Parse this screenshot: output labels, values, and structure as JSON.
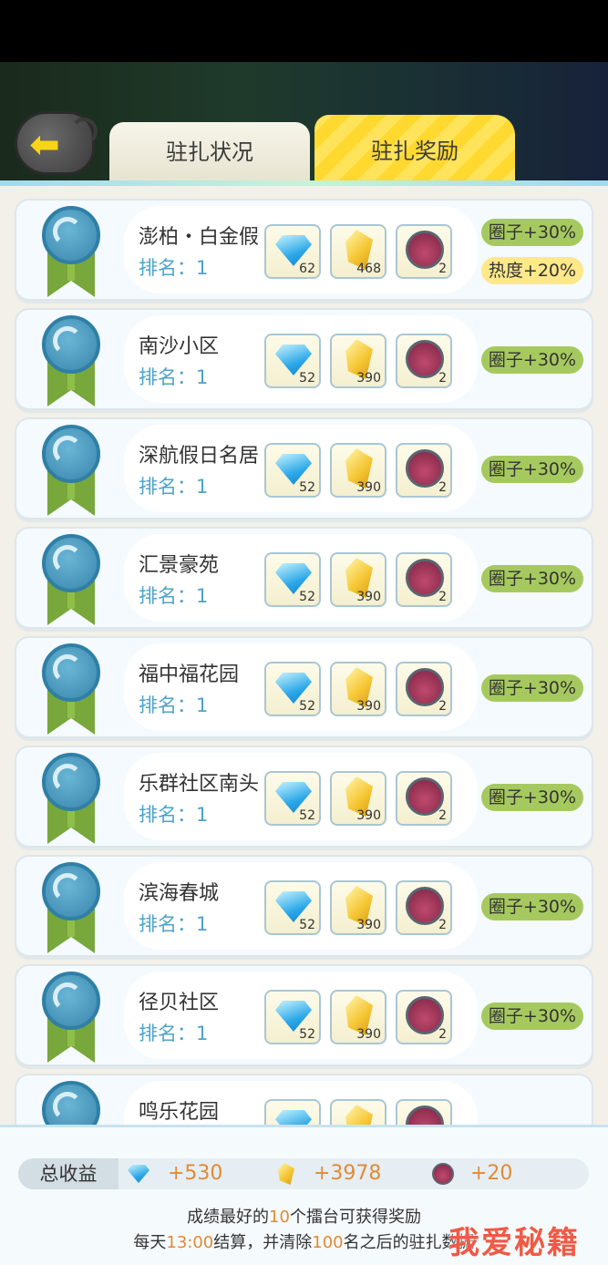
{
  "tabs": [
    {
      "label": "驻扎状况",
      "active": false
    },
    {
      "label": "驻扎奖励",
      "active": true
    }
  ],
  "rank_prefix": "排名：",
  "rows": [
    {
      "name": "澎柏・白金假",
      "rank": "1",
      "gem": "62",
      "gold": "468",
      "pet": "2",
      "badges": [
        "圈子+30%",
        "热度+20%"
      ]
    },
    {
      "name": "南沙小区",
      "rank": "1",
      "gem": "52",
      "gold": "390",
      "pet": "2",
      "badges": [
        "圈子+30%"
      ]
    },
    {
      "name": "深航假日名居",
      "rank": "1",
      "gem": "52",
      "gold": "390",
      "pet": "2",
      "badges": [
        "圈子+30%"
      ]
    },
    {
      "name": "汇景豪苑",
      "rank": "1",
      "gem": "52",
      "gold": "390",
      "pet": "2",
      "badges": [
        "圈子+30%"
      ]
    },
    {
      "name": "福中福花园",
      "rank": "1",
      "gem": "52",
      "gold": "390",
      "pet": "2",
      "badges": [
        "圈子+30%"
      ]
    },
    {
      "name": "乐群社区南头",
      "rank": "1",
      "gem": "52",
      "gold": "390",
      "pet": "2",
      "badges": [
        "圈子+30%"
      ]
    },
    {
      "name": "滨海春城",
      "rank": "1",
      "gem": "52",
      "gold": "390",
      "pet": "2",
      "badges": [
        "圈子+30%"
      ]
    },
    {
      "name": "径贝社区",
      "rank": "1",
      "gem": "52",
      "gold": "390",
      "pet": "2",
      "badges": [
        "圈子+30%"
      ]
    },
    {
      "name": "鸣乐花园",
      "rank": "",
      "gem": "",
      "gold": "",
      "pet": "",
      "badges": []
    }
  ],
  "footer": {
    "total_label": "总收益",
    "gem_total": "+530",
    "gold_total": "+3978",
    "pet_total": "+20",
    "note1_a": "成绩最好的",
    "note1_num": "10",
    "note1_b": "个擂台可获得奖励",
    "note2_a": "每天",
    "note2_time": "13:00",
    "note2_b": "结算，并清除",
    "note2_num": "100",
    "note2_c": "名之后的驻扎数据"
  },
  "watermark": "我爱秘籍",
  "colors": {
    "badge_circle": "#a6c95f",
    "badge_heat": "#fde88a",
    "rank": "#4ea3c9",
    "highlight": "#e28a33"
  }
}
